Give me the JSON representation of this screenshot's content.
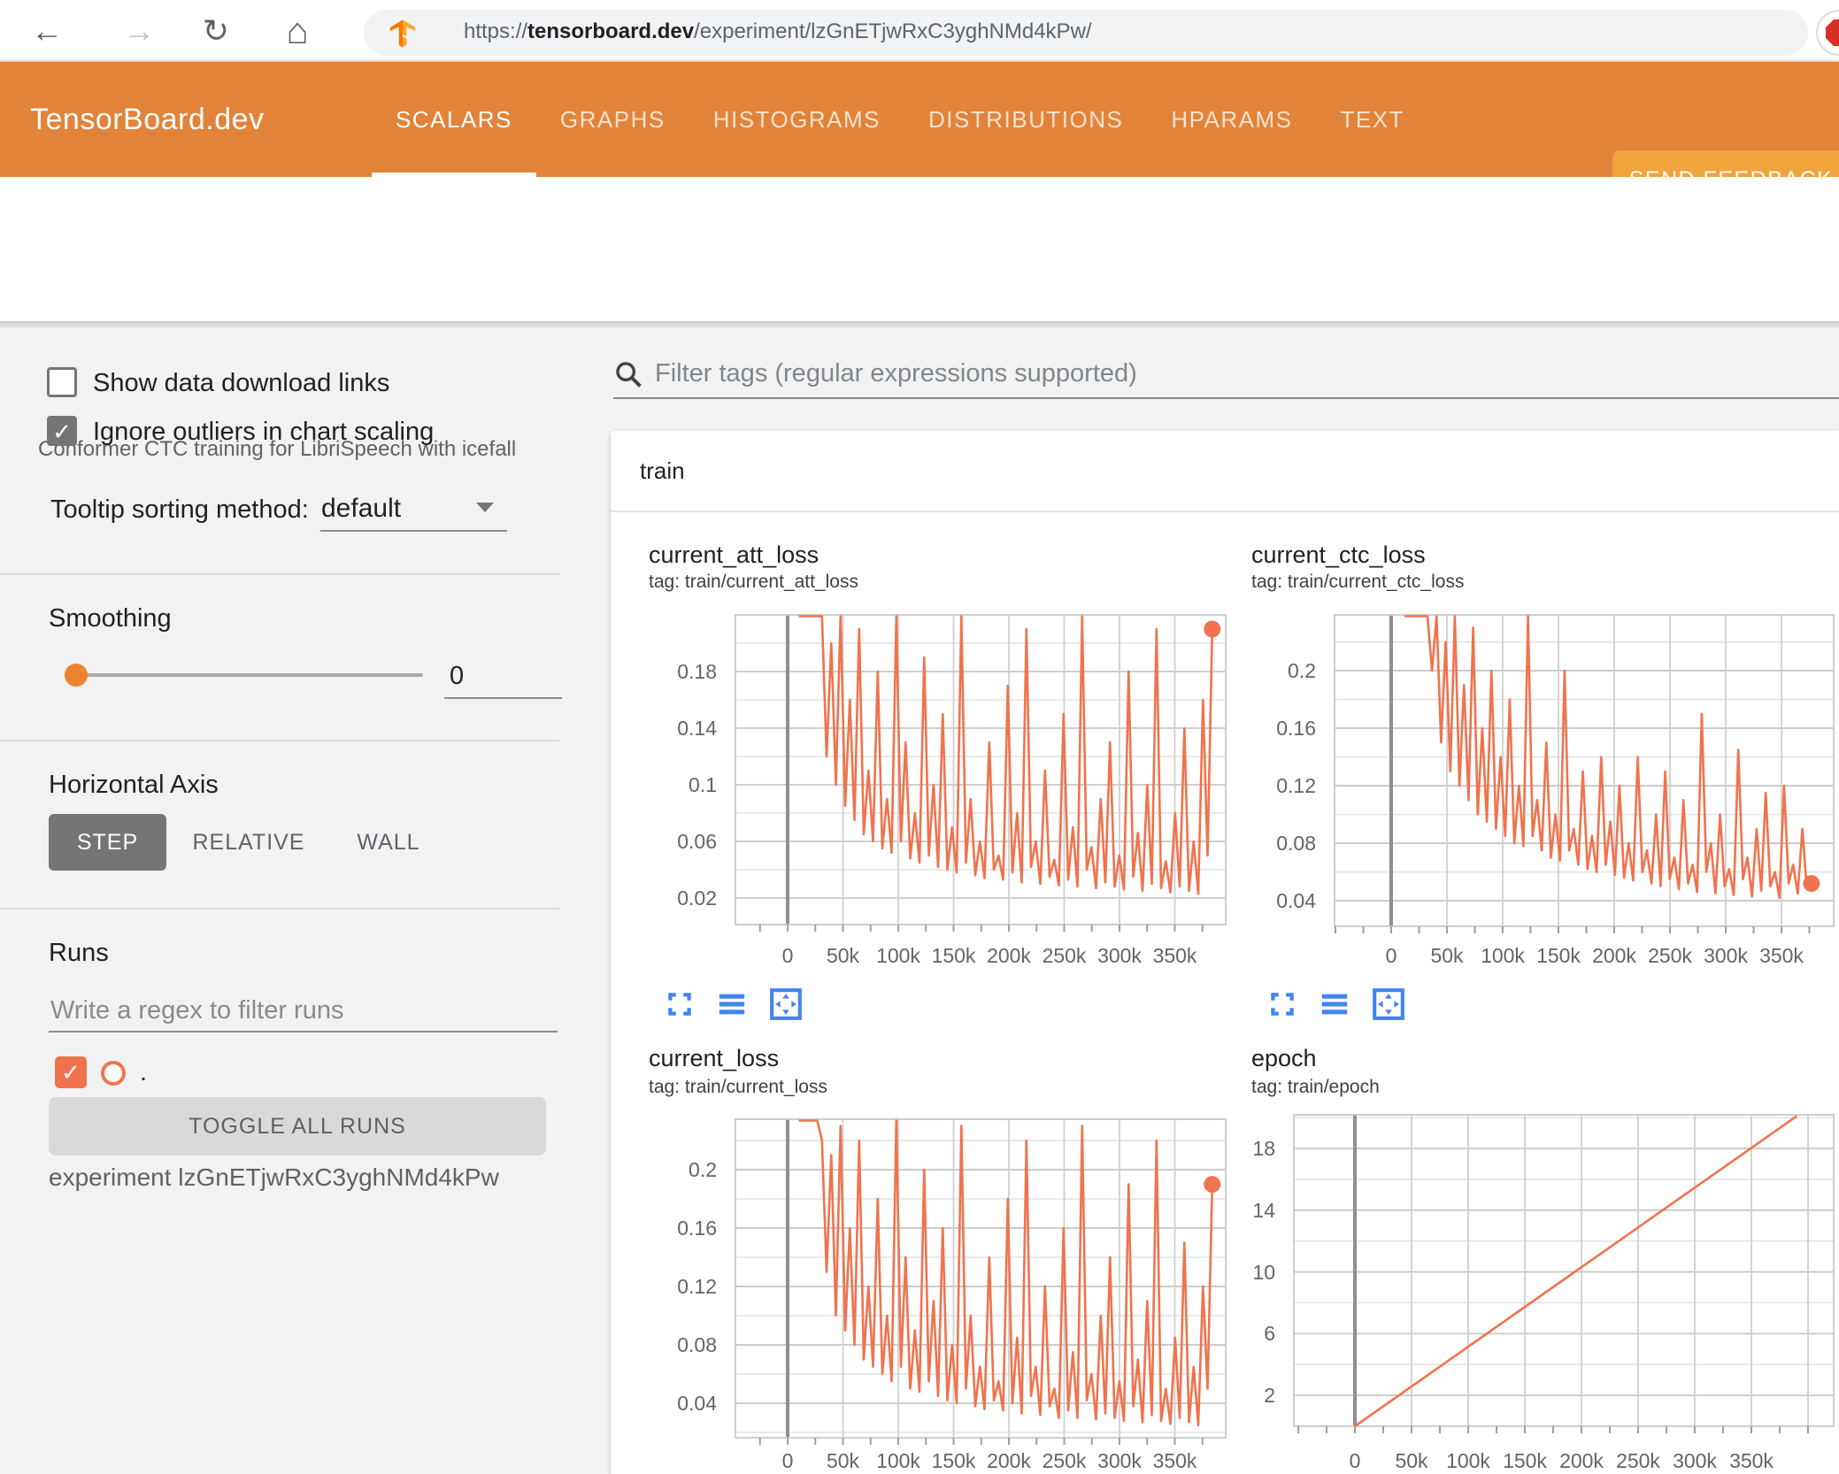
{
  "colors": {
    "accent": "#e2833a",
    "accent_light": "#f1a33c",
    "chart_line": "#f0734d",
    "run_orange": "#f0734d",
    "icon_blue": "#4184f3",
    "stop_red": "#d93025"
  },
  "browser": {
    "back_icon": "←",
    "forward_icon": "→",
    "reload_icon": "↻",
    "home_icon": "⌂",
    "url_prefix": "https://",
    "url_domain": "tensorboard.dev",
    "url_path": "/experiment/lzGnETjwRxC3yghNMd4kPw/"
  },
  "header": {
    "logo": "TensorBoard.dev",
    "tabs": [
      {
        "label": "SCALARS",
        "active": true
      },
      {
        "label": "GRAPHS",
        "active": false
      },
      {
        "label": "HISTOGRAMS",
        "active": false
      },
      {
        "label": "DISTRIBUTIONS",
        "active": false
      },
      {
        "label": "HPARAMS",
        "active": false
      },
      {
        "label": "TEXT",
        "active": false
      }
    ],
    "feedback_label": "SEND FEEDBACK"
  },
  "subtitle": "Conformer CTC training for LibriSpeech with icefall",
  "sidebar": {
    "show_download_label": "Show data download links",
    "ignore_outliers_label": "Ignore outliers in chart scaling",
    "tooltip_sorting_label": "Tooltip sorting method:",
    "tooltip_sorting_value": "default",
    "smoothing_label": "Smoothing",
    "smoothing_value": "0",
    "horizontal_axis_label": "Horizontal Axis",
    "axis_step": "STEP",
    "axis_relative": "RELATIVE",
    "axis_wall": "WALL",
    "runs_label": "Runs",
    "runs_filter_placeholder": "Write a regex to filter runs",
    "run_item_label": ".",
    "toggle_all_label": "TOGGLE ALL RUNS",
    "experiment_label": "experiment lzGnETjwRxC3yghNMd4kPw"
  },
  "main": {
    "filter_placeholder": "Filter tags (regular expressions supported)",
    "card_title": "train"
  },
  "chart_data": [
    {
      "id": "current_att_loss",
      "type": "line",
      "title": "current_att_loss",
      "tag": "tag: train/current_att_loss",
      "xlabel": "step",
      "ylabel": "",
      "legend": "none",
      "grid": true,
      "x_tick_labels": [
        "0",
        "50k",
        "100k",
        "150k",
        "200k",
        "250k",
        "300k",
        "350k"
      ],
      "x_tick_k": [
        0,
        50,
        100,
        150,
        200,
        250,
        300,
        350
      ],
      "y_tick_labels": [
        "0.02",
        "0.06",
        "0.1",
        "0.14",
        "0.18"
      ],
      "y_tick_values": [
        0.02,
        0.06,
        0.1,
        0.14,
        0.18
      ],
      "ylim": [
        0.00125,
        0.22
      ],
      "xlim_k": [
        -47,
        396
      ],
      "series": {
        "run": ".",
        "x_start_k": 10,
        "x_step_k": 4.2,
        "values": [
          0.46,
          0.35,
          0.3,
          0.27,
          0.25,
          0.23,
          0.12,
          0.2,
          0.1,
          0.22,
          0.085,
          0.16,
          0.075,
          0.21,
          0.065,
          0.11,
          0.06,
          0.18,
          0.055,
          0.09,
          0.052,
          0.23,
          0.06,
          0.13,
          0.048,
          0.08,
          0.045,
          0.19,
          0.05,
          0.1,
          0.042,
          0.15,
          0.04,
          0.07,
          0.038,
          0.22,
          0.045,
          0.09,
          0.036,
          0.06,
          0.034,
          0.13,
          0.04,
          0.05,
          0.033,
          0.17,
          0.038,
          0.08,
          0.031,
          0.21,
          0.042,
          0.06,
          0.03,
          0.11,
          0.035,
          0.047,
          0.029,
          0.15,
          0.033,
          0.07,
          0.028,
          0.22,
          0.04,
          0.056,
          0.027,
          0.09,
          0.031,
          0.13,
          0.028,
          0.05,
          0.026,
          0.18,
          0.035,
          0.066,
          0.025,
          0.1,
          0.03,
          0.21,
          0.027,
          0.046,
          0.024,
          0.08,
          0.028,
          0.14,
          0.025,
          0.06,
          0.023,
          0.16,
          0.05,
          0.21
        ]
      },
      "end_dot": true
    },
    {
      "id": "current_ctc_loss",
      "type": "line",
      "title": "current_ctc_loss",
      "tag": "tag: train/current_ctc_loss",
      "xlabel": "step",
      "ylabel": "",
      "legend": "none",
      "grid": true,
      "x_tick_labels": [
        "0",
        "50k",
        "100k",
        "150k",
        "200k",
        "250k",
        "300k",
        "350k"
      ],
      "x_tick_k": [
        0,
        50,
        100,
        150,
        200,
        250,
        300,
        350
      ],
      "y_tick_labels": [
        "0.04",
        "0.08",
        "0.12",
        "0.16",
        "0.2"
      ],
      "y_tick_values": [
        0.04,
        0.08,
        0.12,
        0.16,
        0.2
      ],
      "ylim": [
        0.0222,
        0.2388
      ],
      "xlim_k": [
        -51,
        397
      ],
      "series": {
        "run": ".",
        "x_start_k": 12,
        "x_step_k": 4.1,
        "values": [
          0.5,
          0.4,
          0.33,
          0.29,
          0.26,
          0.24,
          0.2,
          0.26,
          0.15,
          0.22,
          0.13,
          0.24,
          0.12,
          0.19,
          0.11,
          0.23,
          0.1,
          0.16,
          0.095,
          0.2,
          0.09,
          0.14,
          0.085,
          0.18,
          0.08,
          0.12,
          0.078,
          0.24,
          0.085,
          0.11,
          0.075,
          0.15,
          0.07,
          0.1,
          0.068,
          0.2,
          0.075,
          0.09,
          0.065,
          0.13,
          0.062,
          0.085,
          0.06,
          0.14,
          0.065,
          0.095,
          0.058,
          0.12,
          0.056,
          0.08,
          0.054,
          0.14,
          0.06,
          0.075,
          0.052,
          0.1,
          0.05,
          0.13,
          0.055,
          0.07,
          0.048,
          0.11,
          0.052,
          0.065,
          0.046,
          0.17,
          0.06,
          0.08,
          0.045,
          0.1,
          0.05,
          0.062,
          0.044,
          0.145,
          0.055,
          0.07,
          0.043,
          0.09,
          0.047,
          0.115,
          0.05,
          0.06,
          0.042,
          0.12,
          0.052,
          0.065,
          0.045,
          0.09,
          0.048,
          0.052
        ]
      },
      "end_dot": true
    },
    {
      "id": "current_loss",
      "type": "line",
      "title": "current_loss",
      "tag": "tag: train/current_loss",
      "xlabel": "step",
      "ylabel": "",
      "legend": "none",
      "grid": true,
      "x_tick_labels": [
        "0",
        "50k",
        "100k",
        "150k",
        "200k",
        "250k",
        "300k",
        "350k"
      ],
      "x_tick_k": [
        0,
        50,
        100,
        150,
        200,
        250,
        300,
        350
      ],
      "y_tick_labels": [
        "0.04",
        "0.08",
        "0.12",
        "0.16",
        "0.2"
      ],
      "y_tick_values": [
        0.04,
        0.08,
        0.12,
        0.16,
        0.2
      ],
      "ylim": [
        0.0164,
        0.2346
      ],
      "xlim_k": [
        -47,
        396
      ],
      "series": {
        "run": ".",
        "x_start_k": 10,
        "x_step_k": 4.2,
        "values": [
          0.48,
          0.37,
          0.31,
          0.28,
          0.25,
          0.22,
          0.13,
          0.21,
          0.1,
          0.23,
          0.09,
          0.16,
          0.08,
          0.22,
          0.07,
          0.12,
          0.065,
          0.18,
          0.06,
          0.1,
          0.055,
          0.24,
          0.065,
          0.14,
          0.05,
          0.09,
          0.048,
          0.2,
          0.055,
          0.11,
          0.045,
          0.16,
          0.042,
          0.08,
          0.04,
          0.23,
          0.05,
          0.1,
          0.038,
          0.065,
          0.036,
          0.14,
          0.042,
          0.055,
          0.035,
          0.18,
          0.04,
          0.085,
          0.033,
          0.22,
          0.045,
          0.065,
          0.032,
          0.12,
          0.038,
          0.05,
          0.03,
          0.16,
          0.035,
          0.075,
          0.03,
          0.23,
          0.042,
          0.06,
          0.029,
          0.1,
          0.033,
          0.14,
          0.03,
          0.055,
          0.028,
          0.19,
          0.038,
          0.07,
          0.027,
          0.11,
          0.032,
          0.22,
          0.028,
          0.05,
          0.026,
          0.085,
          0.03,
          0.15,
          0.027,
          0.065,
          0.025,
          0.12,
          0.05,
          0.19
        ]
      },
      "end_dot": true
    },
    {
      "id": "epoch",
      "type": "line",
      "title": "epoch",
      "tag": "tag: train/epoch",
      "xlabel": "step",
      "ylabel": "",
      "legend": "none",
      "grid": true,
      "x_tick_labels": [
        "0",
        "50k",
        "100k",
        "150k",
        "200k",
        "250k",
        "300k",
        "350k"
      ],
      "x_tick_k": [
        0,
        50,
        100,
        150,
        200,
        250,
        300,
        350
      ],
      "y_tick_labels": [
        "2",
        "6",
        "10",
        "14",
        "18"
      ],
      "y_tick_values": [
        2,
        6,
        10,
        14,
        18
      ],
      "ylim": [
        0,
        20.18
      ],
      "xlim_k": [
        -54,
        423
      ],
      "points_k": [
        [
          0,
          0
        ],
        [
          390,
          20.3
        ]
      ],
      "end_dot": false
    }
  ]
}
